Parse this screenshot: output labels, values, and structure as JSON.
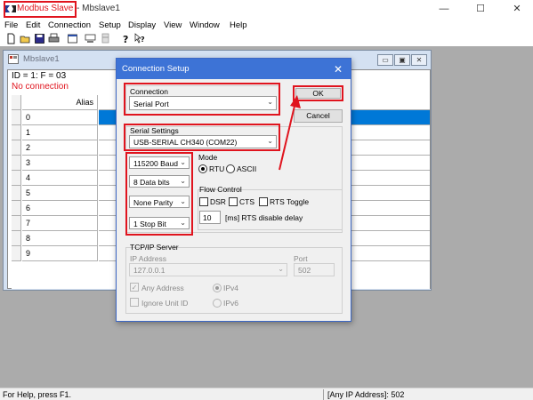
{
  "app": {
    "title_app": "Modbus Slave",
    "title_doc": " - Mbslave1",
    "controls": [
      "—",
      "☐",
      "✕"
    ]
  },
  "menu": [
    "File",
    "Edit",
    "Connection",
    "Setup",
    "Display",
    "View",
    "Window",
    "Help"
  ],
  "toolbar_icons": [
    "new-icon",
    "open-icon",
    "save-icon",
    "print-icon",
    "window-icon",
    "connect-icon",
    "disconnect-icon",
    "help-icon",
    "context-help-icon"
  ],
  "child": {
    "title": "Mbslave1",
    "id_line": "ID = 1: F = 03",
    "status": "No connection",
    "column_header": "Alias",
    "rows": [
      "0",
      "1",
      "2",
      "3",
      "4",
      "5",
      "6",
      "7",
      "8",
      "9"
    ],
    "buttons": [
      "▭",
      "▣",
      "✕"
    ]
  },
  "dialog": {
    "title": "Connection Setup",
    "close": "✕",
    "connection_label": "Connection",
    "connection_value": "Serial Port",
    "serial_label": "Serial Settings",
    "serial_value": "USB-SERIAL CH340 (COM22)",
    "baud": "115200 Baud",
    "data_bits": "8 Data bits",
    "parity": "None Parity",
    "stop_bits": "1 Stop Bit",
    "mode_label": "Mode",
    "mode_rtu": "RTU",
    "mode_ascii": "ASCII",
    "flow_label": "Flow Control",
    "dsr": "DSR",
    "cts": "CTS",
    "rts_toggle": "RTS Toggle",
    "rts_delay_value": "10",
    "rts_delay_label": "[ms] RTS disable delay",
    "ok": "OK",
    "cancel": "Cancel",
    "tcp_label": "TCP/IP Server",
    "ip_label": "IP Address",
    "ip_value": "127.0.0.1",
    "port_label": "Port",
    "port_value": "502",
    "any_address": "Any Address",
    "ignore_unit": "Ignore Unit ID",
    "ipv4": "IPv4",
    "ipv6": "IPv6"
  },
  "status": {
    "left": "For Help, press F1.",
    "right": "[Any IP Address]: 502"
  },
  "colors": {
    "highlight": "#e0141e",
    "dialog_title": "#3d73d6",
    "mdi_bg": "#ababab"
  }
}
